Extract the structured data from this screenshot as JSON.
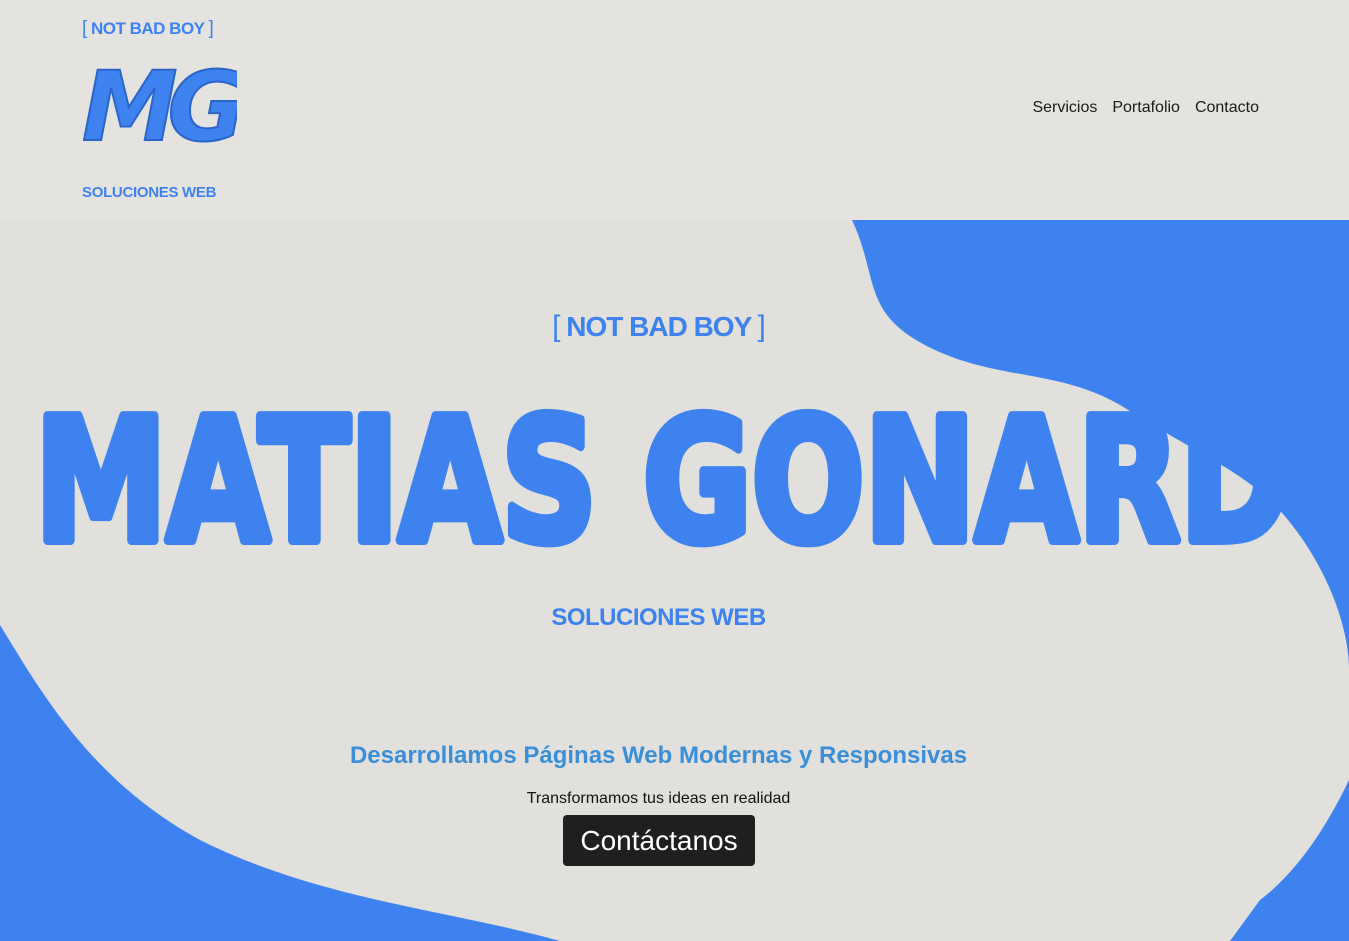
{
  "colors": {
    "accent": "#3d82ef",
    "background": "#e2e1dd",
    "button": "#1f1f1f",
    "headline": "#3a8fd8"
  },
  "header": {
    "logo": {
      "tag_open": "[",
      "tag_text": "NOT BAD BOY",
      "tag_close": "]",
      "mark": "MG",
      "subtitle": "SOLUCIONES WEB"
    },
    "nav": [
      {
        "label": "Servicios"
      },
      {
        "label": "Portafolio"
      },
      {
        "label": "Contacto"
      }
    ]
  },
  "hero": {
    "tag_open": "[",
    "tag_text": "NOT BAD BOY",
    "tag_close": "]",
    "name": "MATIAS GONARD",
    "subtitle": "SOLUCIONES WEB",
    "headline": "Desarrollamos Páginas Web Modernas y Responsivas",
    "tagline": "Transformamos tus ideas en realidad",
    "cta_label": "Contáctanos"
  }
}
